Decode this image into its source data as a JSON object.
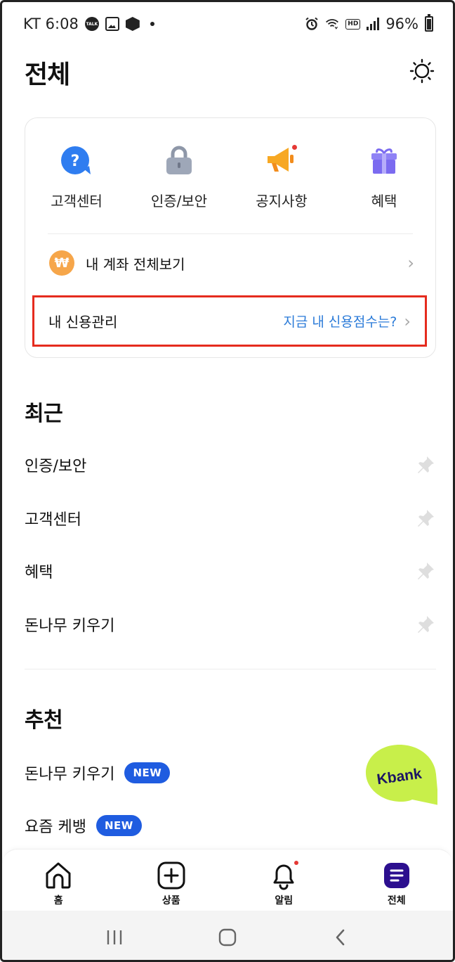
{
  "status_bar": {
    "carrier_time": "KT 6:08",
    "battery": "96%",
    "talk_badge": "TALK",
    "hd_badge": "HD"
  },
  "header": {
    "title": "전체"
  },
  "quick_menu": {
    "items": [
      {
        "label": "고객센터",
        "icon": "question-bubble-icon",
        "color": "#2f7df0"
      },
      {
        "label": "인증/보안",
        "icon": "lock-icon",
        "color": "#9ea7b8"
      },
      {
        "label": "공지사항",
        "icon": "megaphone-icon",
        "color": "#f7a823",
        "has_dot": true
      },
      {
        "label": "혜택",
        "icon": "gift-icon",
        "color": "#7b6bf0"
      }
    ],
    "accounts": {
      "label": "내 계좌 전체보기",
      "icon_text": "₩",
      "icon": "won-coin-icon"
    },
    "credit": {
      "label": "내 신용관리",
      "link": "지금 내 신용점수는?"
    }
  },
  "recent": {
    "title": "최근",
    "items": [
      {
        "label": "인증/보안"
      },
      {
        "label": "고객센터"
      },
      {
        "label": "혜택"
      },
      {
        "label": "돈나무 키우기"
      }
    ]
  },
  "recommend": {
    "title": "추천",
    "items": [
      {
        "label": "돈나무 키우기",
        "badge": "NEW"
      },
      {
        "label": "요즘 케뱅",
        "badge": "NEW"
      }
    ]
  },
  "fab": {
    "label": "Kbank",
    "color": "#c8ef4a",
    "text_color": "#1b1464"
  },
  "bottom_nav": {
    "items": [
      {
        "label": "홈",
        "icon": "home-icon"
      },
      {
        "label": "상품",
        "icon": "plus-square-icon"
      },
      {
        "label": "알림",
        "icon": "bell-icon",
        "has_dot": true
      },
      {
        "label": "전체",
        "icon": "menu-icon",
        "active": true
      }
    ]
  },
  "colors": {
    "accent_blue": "#2b7bd8",
    "badge_blue": "#1f5ce0",
    "highlight_red": "#e52b1e",
    "active_nav": "#2c0f8f"
  }
}
